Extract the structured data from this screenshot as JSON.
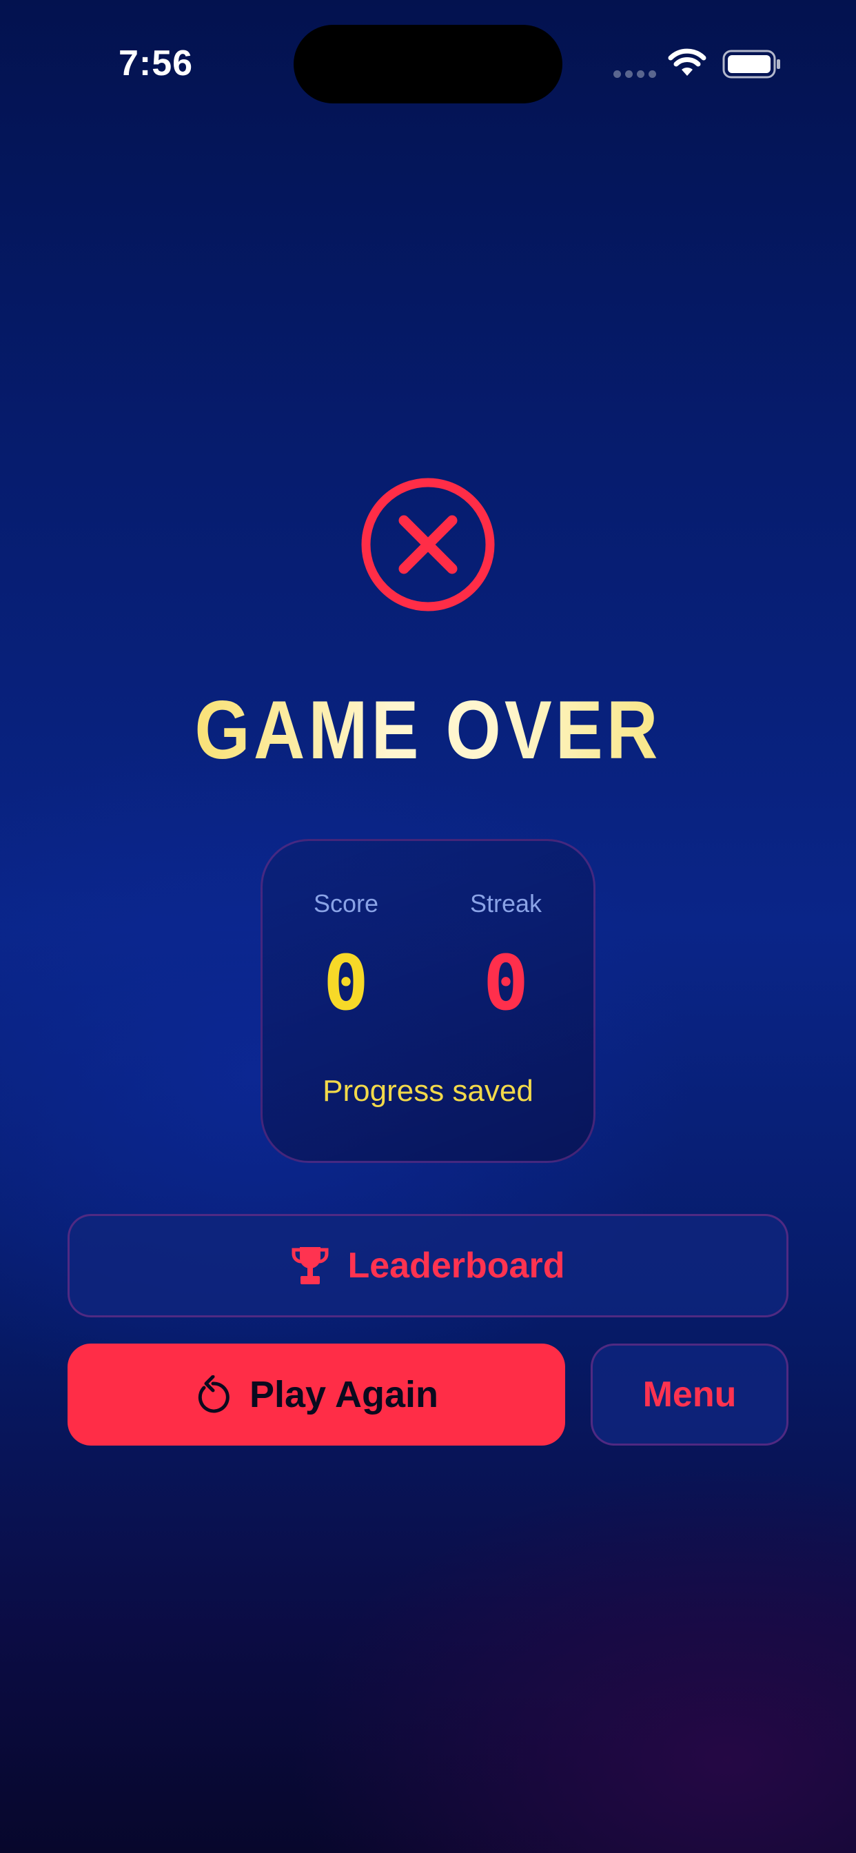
{
  "status_bar": {
    "time": "7:56",
    "icons": [
      "signal-icon",
      "wifi-icon",
      "battery-icon"
    ]
  },
  "game_over": {
    "icon": "x-circle-icon",
    "title": "GAME OVER"
  },
  "stats": {
    "score_label": "Score",
    "score_value": "0",
    "streak_label": "Streak",
    "streak_value": "0",
    "status_text": "Progress saved"
  },
  "buttons": {
    "leaderboard": {
      "label": "Leaderboard",
      "icon": "trophy-icon"
    },
    "play_again": {
      "label": "Play Again",
      "icon": "restart-icon"
    },
    "menu": {
      "label": "Menu"
    }
  },
  "colors": {
    "accent_red": "#ff2d47",
    "accent_yellow": "#f7d928",
    "label_blue": "#8aa3e6",
    "background_blue": "#0a2588"
  }
}
